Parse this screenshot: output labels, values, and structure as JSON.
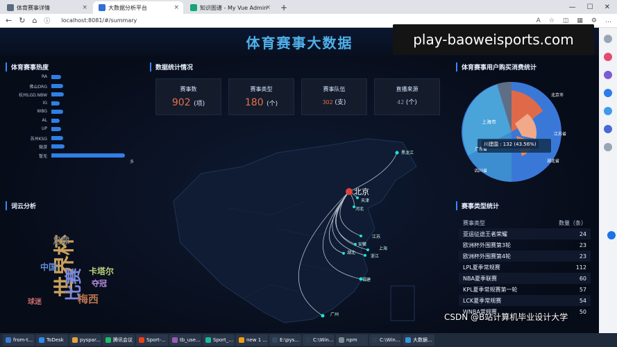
{
  "browser": {
    "tabs": [
      {
        "label": "体育赛事详情",
        "active": false
      },
      {
        "label": "大数据分析平台",
        "active": true
      },
      {
        "label": "知识图谱 - My Vue Admin",
        "active": false
      }
    ],
    "url": "localhost:8081/#/summary"
  },
  "watermark": "play-baoweisports.com",
  "csdn": "CSDN @B站计算机毕业设计大学",
  "dashboard": {
    "title": "体育赛事大数据",
    "sections": {
      "heat": "体育赛事热度",
      "stats": "数据统计情况",
      "purchase": "体育赛事用户购买消费统计",
      "wordcloud": "词云分析",
      "types": "赛事类型统计"
    },
    "heat_bars": [
      {
        "label": "RA",
        "value": 12
      },
      {
        "label": "佛山DRG",
        "value": 14
      },
      {
        "label": "杭州LGD.NBW",
        "value": 15
      },
      {
        "label": "IG",
        "value": 10
      },
      {
        "label": "WBG",
        "value": 14
      },
      {
        "label": "AL",
        "value": 10
      },
      {
        "label": "UP",
        "value": 12
      },
      {
        "label": "苏州KSG",
        "value": 14
      },
      {
        "label": "微游",
        "value": 16
      },
      {
        "label": "暂无",
        "value": 88
      }
    ],
    "heat_max_label": "多",
    "stats": [
      {
        "name": "赛事数",
        "value": "902",
        "unit": "(项)"
      },
      {
        "name": "赛事类型",
        "value": "180",
        "unit": "(个)"
      },
      {
        "name": "赛事队伍",
        "value": "302",
        "unit": "(支)"
      },
      {
        "name": "直播来源",
        "value": "42",
        "unit": "(个)"
      }
    ],
    "map": {
      "center": "北京",
      "cities": [
        "黑龙江",
        "天津",
        "河北",
        "江苏",
        "安徽",
        "上海",
        "浙江",
        "湖北",
        "福建",
        "广州"
      ]
    },
    "pie": {
      "tooltip": "川建国 : 132 (43.56%)",
      "labels": [
        "上海市",
        "北京市",
        "江苏省",
        "湖北省",
        "广东省",
        "四川省",
        "福建省",
        "浙江省",
        "河南省",
        "江苏省"
      ]
    },
    "types_table": {
      "headers": [
        "赛事类型",
        "数量（条）"
      ],
      "rows": [
        [
          "亚运征途王者荣耀",
          "24"
        ],
        [
          "欧洲杯外围赛第3轮",
          "23"
        ],
        [
          "欧洲杯外围赛第4轮",
          "23"
        ],
        [
          "LPL夏季常规赛",
          "112"
        ],
        [
          "NBA夏季联赛",
          "60"
        ],
        [
          "KPL夏季常规赛第一轮",
          "57"
        ],
        [
          "LCK夏季常规赛",
          "54"
        ],
        [
          "WNBA常规赛",
          "50"
        ]
      ]
    },
    "wordcloud": [
      "世界杯",
      "比赛",
      "卡塔尔",
      "梅西",
      "足球",
      "中国",
      "夺冠",
      "球迷"
    ]
  },
  "taskbar": [
    "from-t...",
    "ToDesk",
    "pyspar...",
    "腾讯会议",
    "Sport-...",
    "tb_use...",
    "Sport_...",
    "new 1 ...",
    "E:\\pys...",
    "C:\\Win...",
    "npm",
    "C:\\Win...",
    "大数据..."
  ]
}
